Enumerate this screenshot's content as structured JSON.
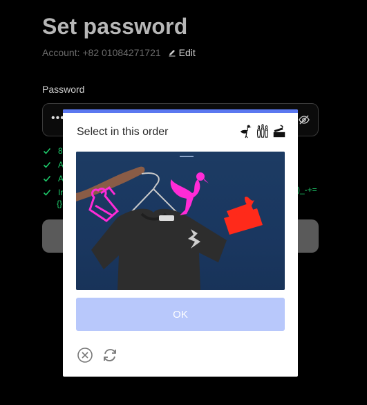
{
  "page": {
    "title": "Set password",
    "account_text": "Account: +82 01084271721",
    "edit_label": "Edit",
    "password_label": "Password",
    "password_value": "•••",
    "rules": [
      {
        "text": "8"
      },
      {
        "text": "A"
      },
      {
        "text": "A"
      },
      {
        "text": "Ir"
      }
    ],
    "rule_tail": ")_-+=",
    "rule_wrap": "{}"
  },
  "captcha": {
    "header": "Select in this order",
    "ok_label": "OK",
    "accent_color": "#5b78f0",
    "order_icons": [
      "flamingo-icon",
      "bowling-pins-icon",
      "lighter-icon"
    ],
    "image_icons": [
      "bowling-pins-icon",
      "flamingo-icon",
      "lighter-icon"
    ],
    "footer_icons": [
      "close-icon",
      "refresh-icon"
    ]
  }
}
